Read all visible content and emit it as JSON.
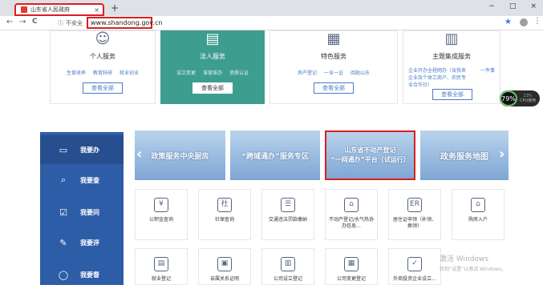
{
  "browser": {
    "tab_title": "山东省人民政府",
    "tab_close": "×",
    "new_tab": "+",
    "window_controls": [
      "−",
      "□",
      "×"
    ],
    "nav": {
      "back": "←",
      "forward": "→",
      "reload": "C"
    },
    "security_label": "不安全",
    "url": "www.shandong.gov.cn",
    "star": "★",
    "more": "⋮"
  },
  "service_cards": [
    {
      "title": "个人服务",
      "icon": "person-icon",
      "links": [
        "生育收养",
        "教育科研",
        "就业创业"
      ],
      "button": "查看全部"
    },
    {
      "title": "法人服务",
      "icon": "id-card-icon",
      "links": [
        "设立变更",
        "准营准办",
        "资质认证"
      ],
      "button": "查看全部"
    },
    {
      "title": "特色服务",
      "icon": "building-icon",
      "links": [
        "房产登记",
        "一业一证",
        "阅政山东"
      ],
      "button": "查看全部"
    },
    {
      "title": "主题集成服务",
      "icon": "document-icon",
      "desc": [
        "企业开办全程网办（含我来",
        "企业及个体工商户、农民专",
        "业合作社）"
      ],
      "extra": "一件事",
      "button": "查看全部"
    }
  ],
  "cpu_widget": {
    "percent": "79%",
    "usage": "23%",
    "label": "CPU使用"
  },
  "sidebar": [
    {
      "icon": "monitor-icon",
      "glyph": "▭",
      "label": "我要办"
    },
    {
      "icon": "search-icon",
      "glyph": "⌕",
      "label": "我要查"
    },
    {
      "icon": "checkbox-icon",
      "glyph": "☑",
      "label": "我要问"
    },
    {
      "icon": "edit-icon",
      "glyph": "✎",
      "label": "我要评"
    },
    {
      "icon": "chat-icon",
      "glyph": "◯",
      "label": "我要督"
    }
  ],
  "banners": [
    {
      "text": "政策服务中央厨房"
    },
    {
      "text": "“跨域通办”服务专区"
    },
    {
      "line1": "山东省不动产登记",
      "line2": "“一网通办”平台（试运行）"
    },
    {
      "text": "政务服务地图"
    }
  ],
  "arrows": {
    "left": "‹",
    "right": "›"
  },
  "services": [
    {
      "label": "公积金查询",
      "glyph": "¥",
      "icon": "fund-icon"
    },
    {
      "label": "社保查询",
      "glyph": "社",
      "icon": "social-security-icon"
    },
    {
      "label": "交通违法罚款缴纳",
      "glyph": "☰",
      "icon": "traffic-icon"
    },
    {
      "label": "不动产登记/水气热协办信息...",
      "glyph": "⌂",
      "icon": "property-icon"
    },
    {
      "label": "居住证申领（补领、换领）",
      "glyph": "ER",
      "icon": "residence-icon"
    },
    {
      "label": "购房入户",
      "glyph": "⌂",
      "icon": "house-icon"
    },
    {
      "label": "就业登记",
      "glyph": "▤",
      "icon": "employment-icon"
    },
    {
      "label": "亲属关系证明",
      "glyph": "▣",
      "icon": "relation-icon"
    },
    {
      "label": "公司设立登记",
      "glyph": "▥",
      "icon": "company-icon"
    },
    {
      "label": "公司变更登记",
      "glyph": "▦",
      "icon": "change-icon"
    },
    {
      "label": "外商投资企业设立...",
      "glyph": "✓",
      "icon": "foreign-icon"
    }
  ],
  "watermark": {
    "line1": "激活 Windows",
    "line2": "转到“设置”以激活 Windows。"
  }
}
